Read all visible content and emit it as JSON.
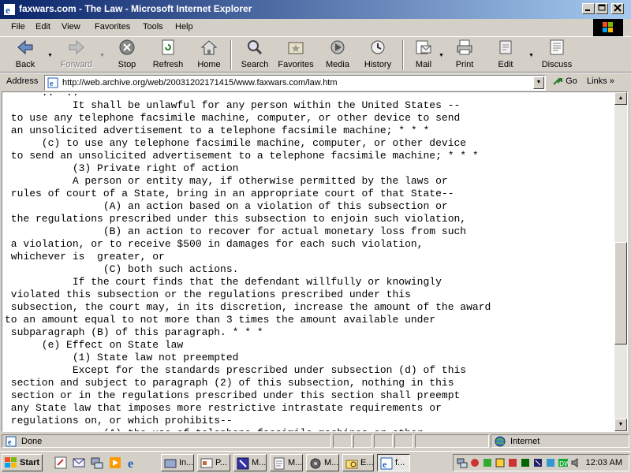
{
  "window": {
    "title": "faxwars.com - The Law - Microsoft Internet Explorer",
    "minimize_icon": "minimize-icon",
    "maximize_icon": "maximize-icon",
    "close_icon": "close-icon"
  },
  "menu": {
    "items": [
      "File",
      "Edit",
      "View",
      "Favorites",
      "Tools",
      "Help"
    ]
  },
  "toolbar": {
    "buttons": [
      {
        "label": "Back",
        "icon": "back-arrow-icon"
      },
      {
        "label": "Forward",
        "icon": "forward-arrow-icon"
      },
      {
        "label": "Stop",
        "icon": "stop-icon"
      },
      {
        "label": "Refresh",
        "icon": "refresh-icon"
      },
      {
        "label": "Home",
        "icon": "home-icon"
      },
      {
        "label": "Search",
        "icon": "search-icon"
      },
      {
        "label": "Favorites",
        "icon": "favorites-icon"
      },
      {
        "label": "Media",
        "icon": "media-icon"
      },
      {
        "label": "History",
        "icon": "history-icon"
      },
      {
        "label": "Mail",
        "icon": "mail-icon"
      },
      {
        "label": "Print",
        "icon": "print-icon"
      },
      {
        "label": "Edit",
        "icon": "edit-icon"
      },
      {
        "label": "Discuss",
        "icon": "discuss-icon"
      }
    ]
  },
  "address": {
    "label": "Address",
    "url": "http://web.archive.org/web/20031202171415/www.faxwars.com/law.htm",
    "go_label": "Go",
    "links_label": "Links",
    "links_chevron": "»"
  },
  "document": {
    "lines": [
      "      ..  ..",
      "           It shall be unlawful for any person within the United States --",
      " to use any telephone facsimile machine, computer, or other device to send",
      " an unsolicited advertisement to a telephone facsimile machine; * * *",
      "      (c) to use any telephone facsimile machine, computer, or other device",
      " to send an unsolicited advertisement to a telephone facsimile machine; * * *",
      "           (3) Private right of action",
      "           A person or entity may, if otherwise permitted by the laws or",
      " rules of court of a State, bring in an appropriate court of that State--",
      "                (A) an action based on a violation of this subsection or",
      " the regulations prescribed under this subsection to enjoin such violation,",
      "                (B) an action to recover for actual monetary loss from such",
      " a violation, or to receive $500 in damages for each such violation,",
      " whichever is  greater, or",
      "                (C) both such actions.",
      "           If the court finds that the defendant willfully or knowingly",
      " violated this subsection or the regulations prescribed under this",
      " subsection, the court may, in its discretion, increase the amount of the award",
      "to an amount equal to not more than 3 times the amount available under",
      " subparagraph (B) of this paragraph. * * *",
      "      (e) Effect on State law",
      "           (1) State law not preempted",
      "           Except for the standards prescribed under subsection (d) of this",
      " section and subject to paragraph (2) of this subsection, nothing in this",
      " section or in the regulations prescribed under this section shall preempt",
      " any State law that imposes more restrictive intrastate requirements or",
      " regulations on, or which prohibits--",
      "                (A) the use of telephone facsimile machines or other"
    ]
  },
  "status": {
    "text": "Done",
    "zone": "Internet"
  },
  "taskbar": {
    "start_label": "Start",
    "tasks": [
      {
        "label": "In...",
        "icon": "inbox-icon"
      },
      {
        "label": "P...",
        "icon": "presentation-icon"
      },
      {
        "label": "M...",
        "icon": "app-icon"
      },
      {
        "label": "M...",
        "icon": "document-icon"
      },
      {
        "label": "M...",
        "icon": "media-player-icon"
      },
      {
        "label": "E...",
        "icon": "explorer-icon"
      },
      {
        "label": "f...",
        "icon": "ie-window-icon"
      }
    ],
    "clock": "12:03 AM"
  }
}
